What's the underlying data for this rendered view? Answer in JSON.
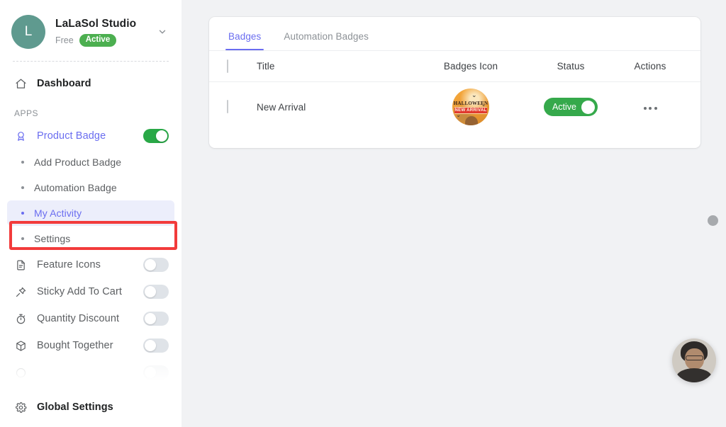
{
  "sidebar": {
    "store": {
      "avatar_letter": "L",
      "name": "LaLaSol Studio",
      "plan": "Free",
      "status_badge": "Active",
      "chevron_icon": "chevron-down-icon"
    },
    "dashboard": {
      "label": "Dashboard",
      "icon": "home-icon"
    },
    "section_label": "APPS",
    "apps": [
      {
        "label": "Product Badge",
        "icon": "badge-icon",
        "toggle": "on",
        "active": true
      },
      {
        "label": "Feature Icons",
        "icon": "document-icon",
        "toggle": "off",
        "active": false
      },
      {
        "label": "Sticky Add To Cart",
        "icon": "pin-icon",
        "toggle": "off",
        "active": false
      },
      {
        "label": "Quantity Discount",
        "icon": "timer-icon",
        "toggle": "off",
        "active": false
      },
      {
        "label": "Bought Together",
        "icon": "box-icon",
        "toggle": "off",
        "active": false
      }
    ],
    "sub_items": [
      {
        "label": "Add Product Badge",
        "selected": false
      },
      {
        "label": "Automation Badge",
        "selected": false
      },
      {
        "label": "My Activity",
        "selected": true
      },
      {
        "label": "Settings",
        "selected": false
      }
    ],
    "footer": {
      "label": "Global Settings",
      "icon": "gear-icon"
    }
  },
  "main": {
    "tabs": [
      {
        "label": "Badges",
        "active": true
      },
      {
        "label": "Automation Badges",
        "active": false
      }
    ],
    "table": {
      "columns": [
        "Title",
        "Badges Icon",
        "Status",
        "Actions"
      ],
      "rows": [
        {
          "title": "New Arrival",
          "badge_icon": {
            "name": "halloween-new-arrival-badge",
            "headline": "HALLOWEEN",
            "ribbon": "NEW ARRIVAL"
          },
          "status": "Active",
          "actions_icon": "kebab-menu-icon"
        }
      ]
    }
  },
  "widgets": {
    "scroll_handle": "scroll-handle",
    "chat_avatar": "support-chat-avatar"
  },
  "annotation": {
    "target": "My Activity",
    "color": "#f23b3b"
  },
  "colors": {
    "accent": "#6a6df0",
    "success": "#35a94b",
    "toggle_on": "#29a847",
    "page_bg": "#f1f2f4",
    "highlight_bg": "#eceefb"
  }
}
